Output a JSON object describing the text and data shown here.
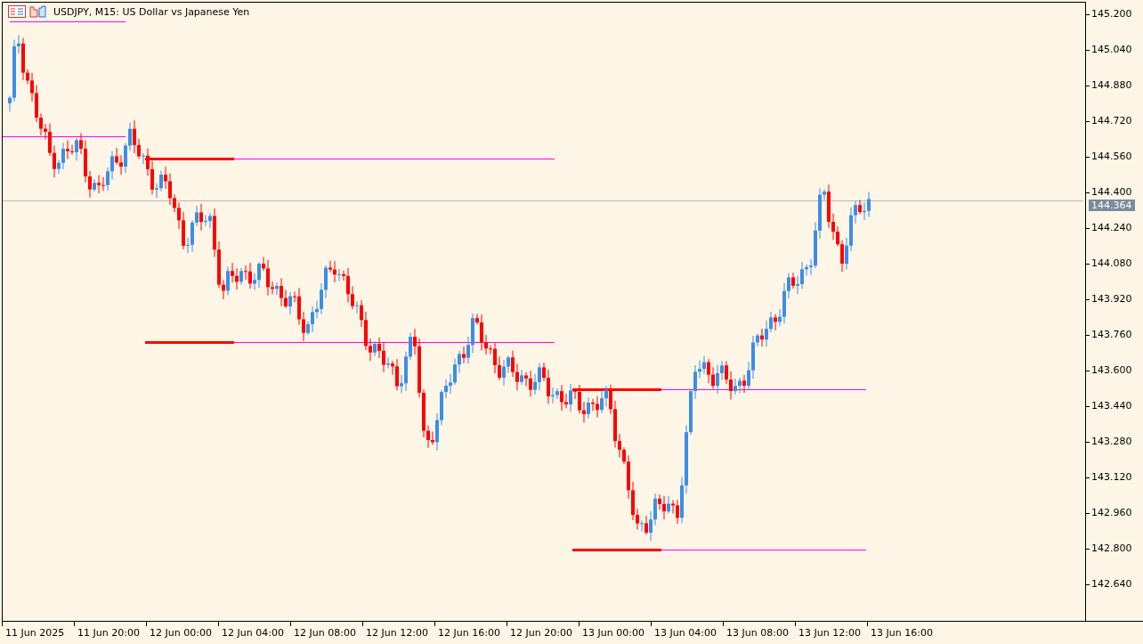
{
  "chart_header": {
    "title": "USDJPY, M15:  US Dollar vs Japanese Yen"
  },
  "price_axis": {
    "labels": [
      "145.200",
      "145.040",
      "144.880",
      "144.720",
      "144.560",
      "144.400",
      "144.240",
      "144.080",
      "143.920",
      "143.760",
      "143.600",
      "143.440",
      "143.280",
      "143.120",
      "142.960",
      "142.800",
      "142.640"
    ],
    "current_price": "144.364"
  },
  "time_axis": {
    "labels": [
      "11 Jun 2025",
      "11 Jun 20:00",
      "12 Jun 00:00",
      "12 Jun 04:00",
      "12 Jun 08:00",
      "12 Jun 12:00",
      "12 Jun 16:00",
      "12 Jun 20:00",
      "13 Jun 00:00",
      "13 Jun 04:00",
      "13 Jun 08:00",
      "13 Jun 12:00",
      "13 Jun 16:00"
    ]
  }
}
